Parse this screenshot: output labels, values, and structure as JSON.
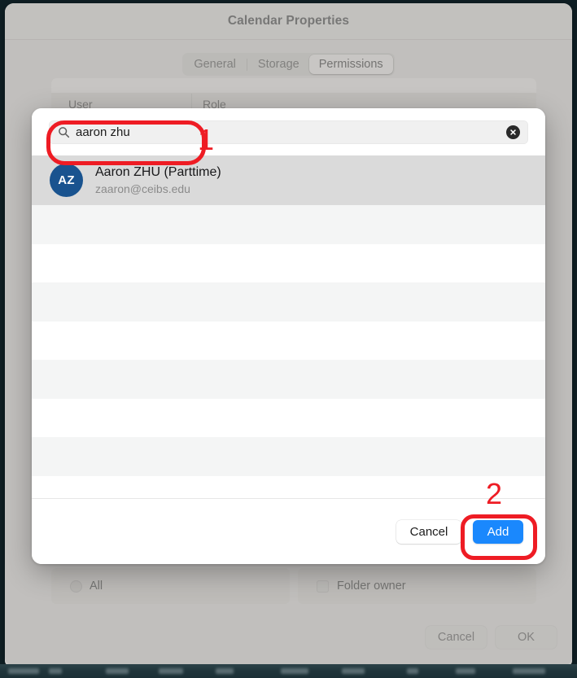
{
  "window": {
    "title": "Calendar Properties",
    "tabs": [
      {
        "label": "General",
        "active": false
      },
      {
        "label": "Storage",
        "active": false
      },
      {
        "label": "Permissions",
        "active": true
      }
    ],
    "table": {
      "columns": [
        "User",
        "Role"
      ]
    },
    "options": [
      {
        "type": "radio",
        "label": "All",
        "checked": false
      },
      {
        "type": "checkbox",
        "label": "Folder owner",
        "checked": false
      }
    ],
    "footer": {
      "cancel_label": "Cancel",
      "ok_label": "OK"
    }
  },
  "sheet": {
    "search": {
      "icon": "search-icon",
      "value": "aaron zhu",
      "placeholder": "",
      "clear_icon": "clear-circle-icon"
    },
    "results": [
      {
        "initials": "AZ",
        "name": "Aaron ZHU (Parttime)",
        "email": "zaaron@ceibs.edu",
        "selected": true
      }
    ],
    "empty_row_count": 7,
    "footer": {
      "cancel_label": "Cancel",
      "add_label": "Add"
    }
  },
  "annotations": [
    {
      "id": "1",
      "label": "1",
      "target": "search-input"
    },
    {
      "id": "2",
      "label": "2",
      "target": "add-button"
    }
  ],
  "colors": {
    "accent_blue": "#1a88fd",
    "avatar_blue": "#19538f",
    "annotation_red": "#ee1c24",
    "selected_row": "#dadada",
    "alt_row": "#f4f5f5"
  }
}
